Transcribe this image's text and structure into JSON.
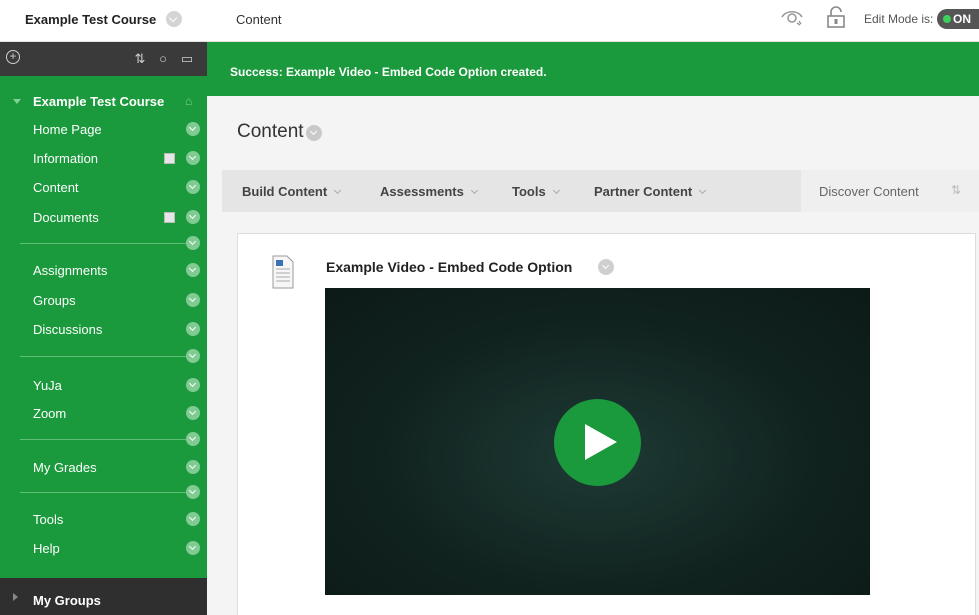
{
  "header": {
    "course_crumb": "Example Test Course",
    "page_crumb": "Content",
    "edit_mode_label": "Edit Mode is:",
    "edit_mode_state": "ON"
  },
  "sidebar": {
    "course_title": "Example Test Course",
    "items": [
      {
        "label": "Home Page",
        "icon": "none"
      },
      {
        "label": "Information",
        "icon": "doc"
      },
      {
        "label": "Content",
        "icon": "none"
      },
      {
        "label": "Documents",
        "icon": "doc"
      },
      {
        "label": "Assignments",
        "icon": "none"
      },
      {
        "label": "Groups",
        "icon": "none"
      },
      {
        "label": "Discussions",
        "icon": "none"
      },
      {
        "label": "YuJa",
        "icon": "none"
      },
      {
        "label": "Zoom",
        "icon": "none"
      },
      {
        "label": "My Grades",
        "icon": "none"
      },
      {
        "label": "Tools",
        "icon": "none"
      },
      {
        "label": "Help",
        "icon": "none"
      }
    ],
    "my_groups": "My Groups"
  },
  "main": {
    "success_message": "Success: Example Video - Embed Code Option created.",
    "page_title": "Content",
    "actions": [
      "Build Content",
      "Assessments",
      "Tools",
      "Partner Content"
    ],
    "discover": "Discover Content",
    "item_title": "Example Video - Embed Code Option"
  },
  "colors": {
    "brand_green": "#1a9a3c",
    "dark_toolbar": "#3a3a3a"
  }
}
